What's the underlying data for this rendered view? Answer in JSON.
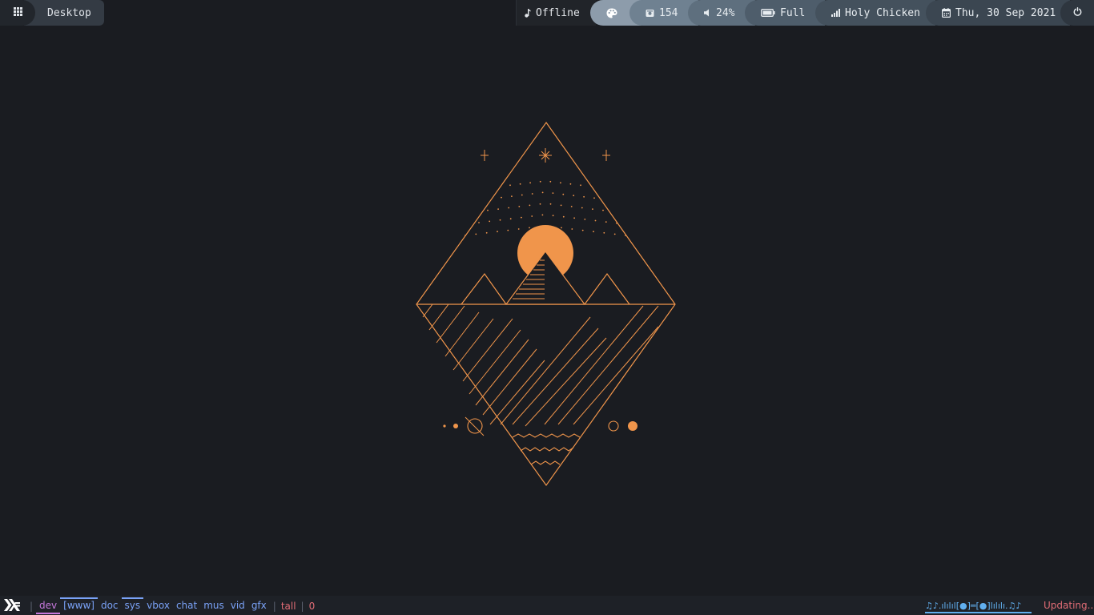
{
  "topbar": {
    "desktop_label": "Desktop",
    "mpd_status": "Offline",
    "disk_value": "154",
    "volume_value": "24%",
    "battery_value": "Full",
    "network_value": "Holy Chicken",
    "date_value": "Thu, 30 Sep 2021"
  },
  "icons": {
    "apps": "apps-grid-icon",
    "music": "music-note-icon",
    "palette": "palette-icon",
    "disk": "disk-icon",
    "volume": "volume-icon",
    "battery": "battery-icon",
    "network": "signal-icon",
    "calendar": "calendar-icon",
    "power": "power-icon",
    "logo": "xmonad-logo-icon"
  },
  "bottombar": {
    "separator": "|",
    "workspaces": [
      "dev",
      "[www]",
      "doc",
      "sys",
      "vbox",
      "chat",
      "mus",
      "vid",
      "gfx"
    ],
    "layout": "tall",
    "window_count": "0",
    "music_visualizer": "♫♪.ılılıl[●]═[●]lılılı.♫♪",
    "status": "Updating..."
  },
  "colors": {
    "background": "#1a1c21",
    "accent_orange": "#f0954b",
    "workspace_blue": "#7aa2f7",
    "workspace_active": "#c678dd",
    "alert_red": "#e06c75"
  }
}
